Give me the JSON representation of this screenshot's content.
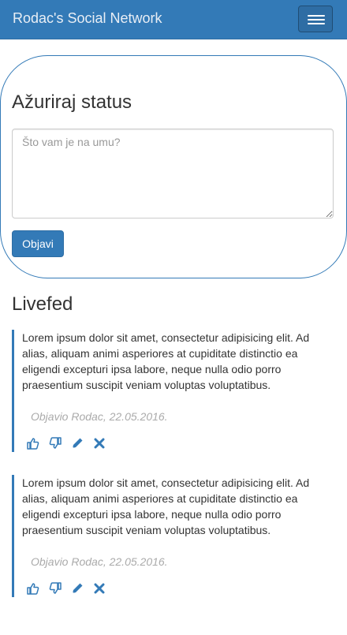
{
  "navbar": {
    "brand": "Rodac's Social Network",
    "toggle_icon": "hamburger-menu-icon"
  },
  "status": {
    "title": "Ažuriraj status",
    "placeholder": "Što vam je na umu?",
    "value": "",
    "submit_label": "Objavi"
  },
  "feed": {
    "title": "Livefed",
    "posts": [
      {
        "text": "Lorem ipsum dolor sit amet, consectetur adipisicing elit. Ad alias, aliquam animi asperiores at cupiditate distinctio ea eligendi excepturi ipsa labore, neque nulla odio porro praesentium suscipit veniam voluptas voluptatibus.",
        "meta": "Objavio Rodac, 22.05.2016.",
        "actions": [
          "thumbs-up-icon",
          "thumbs-down-icon",
          "pencil-icon",
          "close-icon"
        ]
      },
      {
        "text": "Lorem ipsum dolor sit amet, consectetur adipisicing elit. Ad alias, aliquam animi asperiores at cupiditate distinctio ea eligendi excepturi ipsa labore, neque nulla odio porro praesentium suscipit veniam voluptas voluptatibus.",
        "meta": "Objavio Rodac, 22.05.2016.",
        "actions": [
          "thumbs-up-icon",
          "thumbs-down-icon",
          "pencil-icon",
          "close-icon"
        ]
      }
    ]
  },
  "colors": {
    "primary": "#337ab7",
    "meta_text": "#aaaaaa"
  }
}
